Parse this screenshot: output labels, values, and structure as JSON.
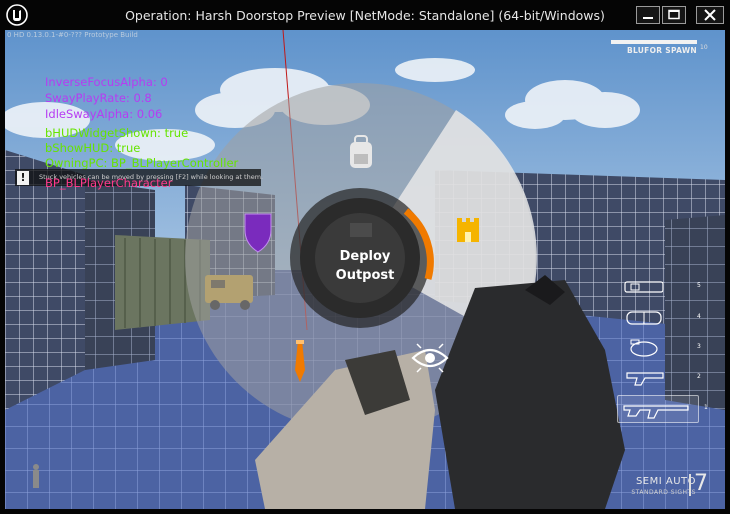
{
  "window": {
    "title": "Operation: Harsh Doorstop Preview [NetMode: Standalone] (64-bit/Windows)",
    "logo_icon": "unreal-engine-logo",
    "controls": [
      "minimize-icon",
      "maximize-icon",
      "close-icon"
    ]
  },
  "hud": {
    "build_info": "0 HD 0.13.0.1-#0-??? Prototype Build",
    "debug_lines_purple": [
      "InverseFocusAlpha: 0",
      "SwayPlayRate: 0.8",
      "IdleSwayAlpha: 0.06"
    ],
    "debug_lines_green": [
      "bHUDWidgetShown: true",
      "bShowHUD: true",
      "OwningPC: BP_BLPlayerController"
    ],
    "debug_line_pink": "BP_BLPlayerCharacter",
    "hint": {
      "icon": "exclamation-icon",
      "text": "Stuck vehicles can be moved by pressing [F2] while looking at them."
    },
    "team_spawn_label": "BLUFOR SPAWN",
    "team_spawn_number": "10",
    "radial_menu": {
      "center_label_line1": "Deploy",
      "center_label_line2": "Outpost",
      "items": [
        {
          "icon": "backpack-icon",
          "state": "normal"
        },
        {
          "icon": "fortification-icon",
          "state": "highlighted",
          "color": "#f5b400"
        },
        {
          "icon": "eye-icon",
          "state": "normal"
        },
        {
          "icon": "marker-pin-icon",
          "state": "normal",
          "color": "#f07a00"
        },
        {
          "icon": "shield-icon",
          "state": "normal",
          "color": "#7a2bbd"
        }
      ],
      "accent_color": "#f07a00"
    },
    "weapon_slots": [
      {
        "number": "5",
        "icon": "binoculars-icon",
        "selected": false
      },
      {
        "number": "4",
        "icon": "bandage-icon",
        "selected": false
      },
      {
        "number": "3",
        "icon": "grenade-icon",
        "selected": false
      },
      {
        "number": "2",
        "icon": "pistol-icon",
        "selected": false
      },
      {
        "number": "1",
        "icon": "rifle-icon",
        "selected": true
      }
    ],
    "fire_mode": "SEMI AUTO",
    "sight_mode": "STANDARD SIGHTS",
    "ammo": "7"
  }
}
